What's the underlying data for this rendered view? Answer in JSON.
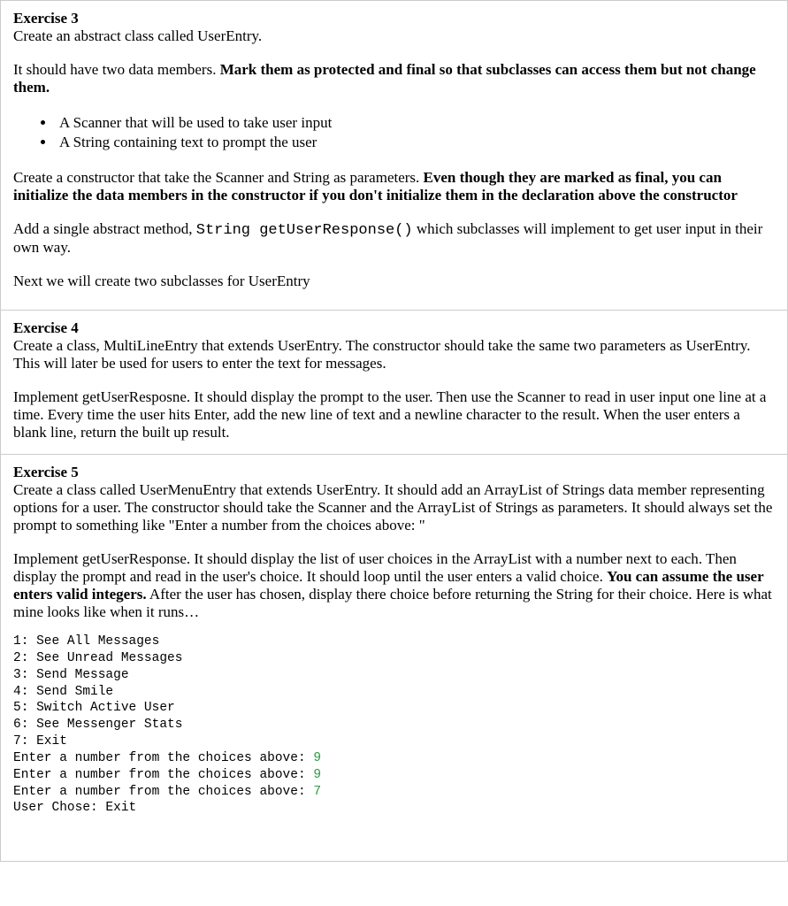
{
  "ex3": {
    "title": "Exercise 3",
    "line1": "Create an abstract class called UserEntry.",
    "line2a": "It should have two data members.  ",
    "line2b": "Mark them as protected and final so that subclasses can access them but not change them.",
    "bullets": [
      "A Scanner that will be used to take user input",
      "A String containing text to prompt the user"
    ],
    "line3a": "Create a constructor that take the Scanner and String as parameters.  ",
    "line3b": "Even though they are marked as final, you can initialize the data members in the constructor if you don't initialize them in the declaration above the constructor",
    "line4a": "Add a single abstract method, ",
    "line4code": "String getUserResponse()",
    "line4b": " which subclasses will implement to get user input in their own way.",
    "line5": "Next we will create two subclasses for UserEntry"
  },
  "ex4": {
    "title": "Exercise 4",
    "line1": "Create a class, MultiLineEntry that extends UserEntry.  The constructor should take the same two parameters as UserEntry.  This will later be used for users to enter the text for messages.",
    "line2": "Implement getUserResposne.  It should display the prompt to the user.  Then use the Scanner to read in user input one line at a time.  Every time the user hits Enter, add the new line of text and a newline character to the result.  When the user enters a blank line, return the built up result."
  },
  "ex5": {
    "title": "Exercise 5",
    "line1": "Create a class called UserMenuEntry that extends UserEntry.  It should add an ArrayList of Strings data member representing options for a user.    The constructor should take the Scanner and the ArrayList of Strings as parameters.  It should always set the prompt to something like \"Enter a number from the choices above: \"",
    "line2a": "Implement getUserResponse.  It should display the list of user choices in the ArrayList with a number next to each.  Then display the prompt and read in the user's choice.  It should loop until the user enters a valid choice.  ",
    "line2b": "You can assume the user enters valid integers.",
    "line2c": "  After the user has chosen, display there choice before returning the String for their choice.  Here is what mine looks like when it runs…",
    "console": {
      "opts": [
        "1: See All Messages",
        "2: See Unread Messages",
        "3: Send Message",
        "4: Send Smile",
        "5: Switch Active User",
        "6: See Messenger Stats",
        "7: Exit"
      ],
      "prompt": "Enter a number from the choices above: ",
      "inputs": [
        "9",
        "9",
        "7"
      ],
      "result": "User Chose: Exit"
    }
  }
}
